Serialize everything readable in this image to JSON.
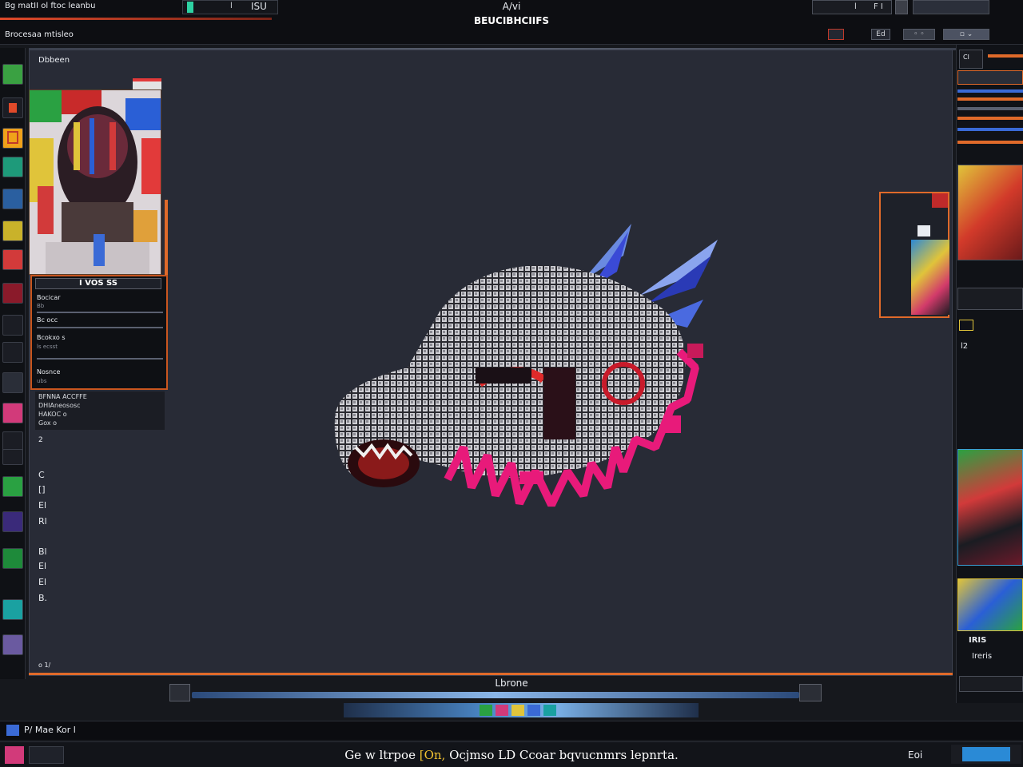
{
  "window": {
    "title_left": "Bg matII ol ftoc leanbu",
    "subtitle_left": "Brocesaa mtisleo",
    "title_center_1": "A/vi",
    "title_center_2": "BEUCIBHCIIFS",
    "ctrl_left_value": "l",
    "ctrl_left_text": "ISU",
    "ctrl_right_value": "l",
    "ctrl_right_text": "F I",
    "ctrl_row_label": "Ed"
  },
  "canvas": {
    "label": "Dbbeen",
    "info_header": "I VOS SS",
    "info_rows": [
      {
        "label": "Bocicar",
        "sub": "Bb"
      },
      {
        "label": "Bc occ",
        "sub": ""
      },
      {
        "label": "Bcokxo s",
        "sub": "ls ecsst"
      },
      {
        "label": "Nosnce",
        "sub": "ubs"
      }
    ],
    "list_rows": [
      "BFNNA ACCFFE",
      "DHIAneososc",
      "HAKOC o",
      "Gox o"
    ],
    "side_letters": [
      "2",
      "C",
      "[]",
      "El",
      "Rl",
      "Bl",
      "El",
      "El",
      "B."
    ],
    "bottom_left": "o 1/"
  },
  "timeline": {
    "label": "Lbrone"
  },
  "status": {
    "left_text": "P/ Mae Kor l",
    "message_pre": "Ge w ltrpoe ",
    "message_hl": "[On,",
    "message_post": " Ocjmso LD Ccoar bqvucnmrs lepnrta.",
    "right_text": "Eoi",
    "logo_text": ""
  },
  "right_panel": {
    "label_1": "Cl ",
    "label_2": "IRIS",
    "label_3": "Ireris",
    "label_4": "l2"
  },
  "colors": {
    "accent_orange": "#e06a2a",
    "canvas_bg": "#282b36",
    "progress_blue": "#4a86c6",
    "highlight_yellow": "#f1c232"
  }
}
